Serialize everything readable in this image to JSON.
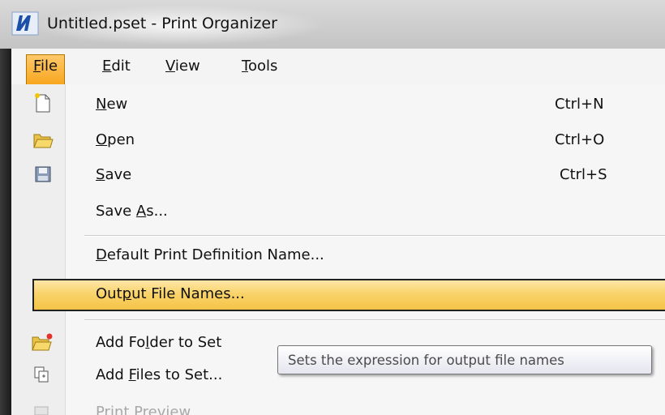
{
  "window": {
    "title": "Untitled.pset - Print Organizer"
  },
  "menubar": {
    "items": [
      {
        "label_pre": "",
        "mnemonic": "F",
        "label_post": "ile",
        "active": true
      },
      {
        "label_pre": "",
        "mnemonic": "E",
        "label_post": "dit",
        "active": false
      },
      {
        "label_pre": "",
        "mnemonic": "V",
        "label_post": "iew",
        "active": false
      },
      {
        "label_pre": "",
        "mnemonic": "T",
        "label_post": "ools",
        "active": false
      }
    ]
  },
  "file_menu": {
    "new": {
      "pre": "",
      "mn": "N",
      "post": "ew",
      "shortcut": "Ctrl+N"
    },
    "open": {
      "pre": "",
      "mn": "O",
      "post": "pen",
      "shortcut": "Ctrl+O"
    },
    "save": {
      "pre": "",
      "mn": "S",
      "post": "ave",
      "shortcut": "Ctrl+S"
    },
    "save_as": {
      "pre": "Save ",
      "mn": "A",
      "post": "s..."
    },
    "default_print_def": {
      "pre": "",
      "mn": "D",
      "post": "efault Print Definition Name..."
    },
    "output_file_names": {
      "pre": "Out",
      "mn": "p",
      "post": "ut File Names..."
    },
    "add_folder": {
      "pre": "Add Fo",
      "mn": "l",
      "post": "der to Set"
    },
    "add_files": {
      "pre": "Add ",
      "mn": "F",
      "post": "iles to Set..."
    },
    "print_preview": {
      "label": "Print Preview"
    }
  },
  "tooltip": {
    "text": "Sets the expression for output file names"
  },
  "colors": {
    "highlight": "#f9d36a",
    "active_menu": "#f7a51c"
  }
}
